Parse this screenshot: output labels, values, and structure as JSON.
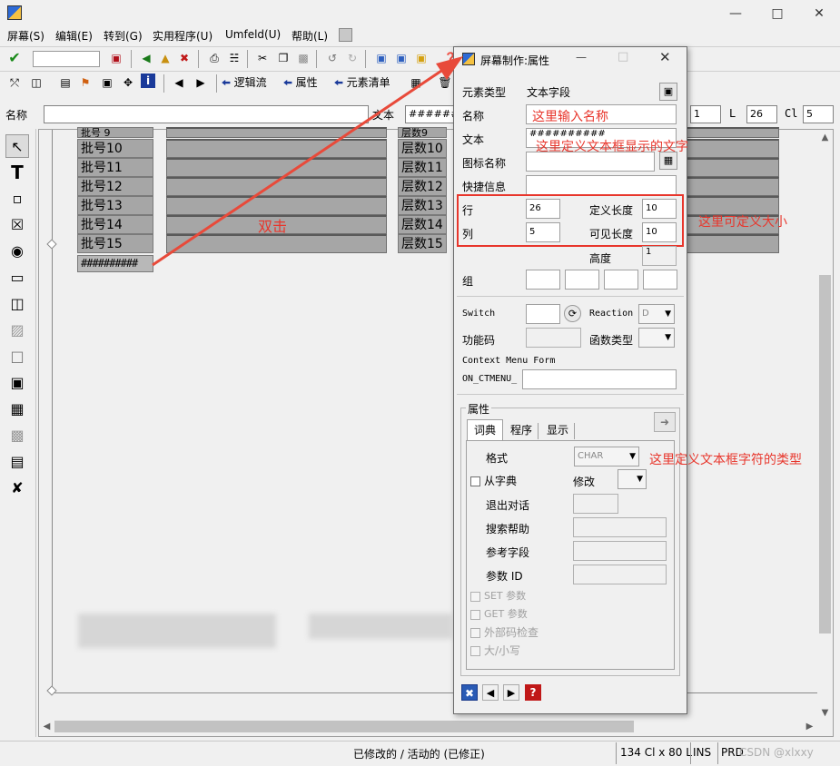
{
  "menu": [
    "屏幕(S)",
    "编辑(E)",
    "转到(G)",
    "实用程序(U)",
    "Umfeld(U)",
    "帮助(L)"
  ],
  "toolbar2": {
    "logic_flow": "逻辑流",
    "attributes": "属性",
    "element_list": "元素清单"
  },
  "namebar": {
    "name_label": "名称",
    "text_label": "文本",
    "text_value": "##########",
    "field1": "1",
    "l_label": "L",
    "l_value": "26",
    "cl_label": "Cl",
    "cl_value": "5"
  },
  "canvas": {
    "rows": [
      {
        "left": "批号 9",
        "right": "层数9"
      },
      {
        "left": "批号10",
        "right": "层数10"
      },
      {
        "left": "批号11",
        "right": "层数11"
      },
      {
        "left": "批号12",
        "right": "层数12"
      },
      {
        "left": "批号13",
        "right": "层数13"
      },
      {
        "left": "批号14",
        "right": "层数14"
      },
      {
        "left": "批号15",
        "right": "层数15"
      }
    ],
    "hash_field": "##########",
    "double_click_note": "双击"
  },
  "dialog": {
    "title": "屏幕制作:属性",
    "element_type_label": "元素类型",
    "element_type_value": "文本字段",
    "name_label": "名称",
    "name_note": "这里输入名称",
    "text_label": "文本",
    "text_value": "##########",
    "text_note": "这里定义文本框显示的文字",
    "icon_label": "图标名称",
    "quick_label": "快捷信息",
    "row_label": "行",
    "row_value": "26",
    "col_label": "列",
    "col_value": "5",
    "def_len_label": "定义长度",
    "def_len_value": "10",
    "vis_len_label": "可见长度",
    "vis_len_value": "10",
    "size_note": "这里可定义大小",
    "height_label": "高度",
    "height_value": "1",
    "group_label": "组",
    "switch_label": "Switch",
    "reaction_label": "Reaction",
    "reaction_value": "D",
    "fcode_label": "功能码",
    "ftype_label": "函数类型",
    "context_label": "Context Menu Form",
    "ctmenu_label": "ON_CTMENU_",
    "attr_group": "属性",
    "tabs": [
      "词典",
      "程序",
      "显示"
    ],
    "format_label": "格式",
    "format_value": "CHAR",
    "format_note": "这里定义文本框字符的类型",
    "from_dict_label": "从字典",
    "modify_label": "修改",
    "exit_dialog_label": "退出对话",
    "search_help_label": "搜索帮助",
    "ref_field_label": "参考字段",
    "param_id_label": "参数 ID",
    "set_param_label": "SET 参数",
    "get_param_label": "GET 参数",
    "ext_check_label": "外部码检查",
    "case_label": "大/小写"
  },
  "status": {
    "message": "已修改的 / 活动的 (已修正)",
    "size": "134 Cl x 80 L",
    "mode": "INS",
    "system": "PRD",
    "watermark": "CSDN @xlxxy"
  },
  "colors": {
    "annotation_red": "#e8362c",
    "canvas_gray": "#a6a6a6",
    "dialog_bg": "#f0f0f0"
  }
}
